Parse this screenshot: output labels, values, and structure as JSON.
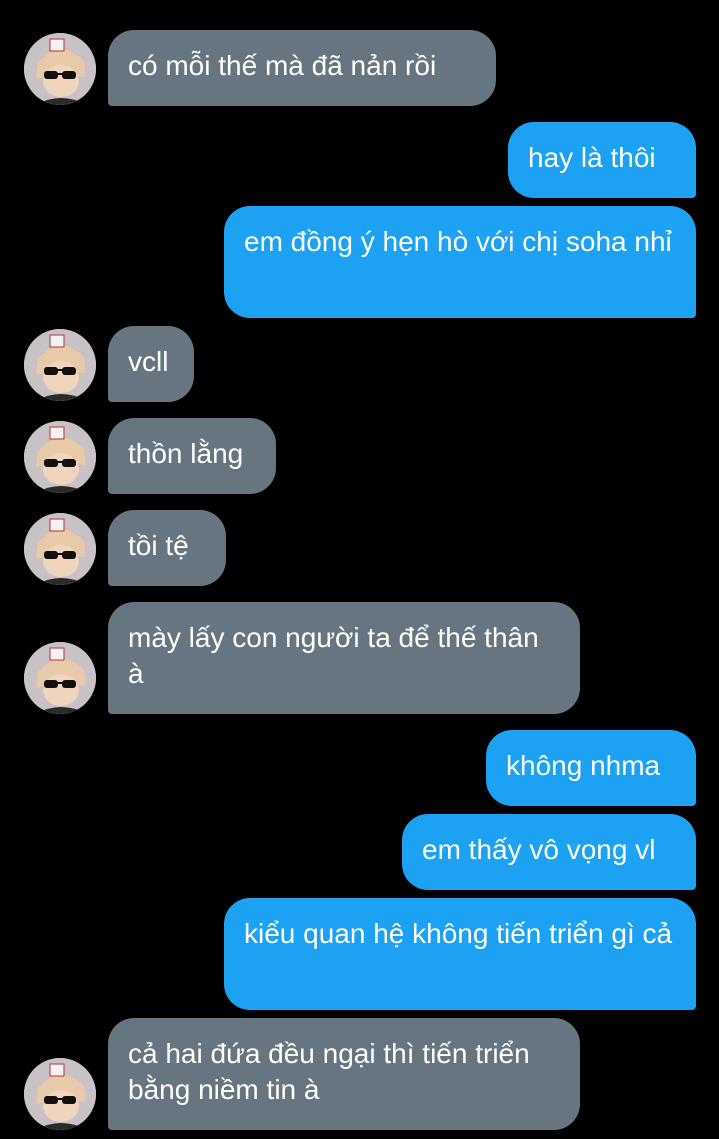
{
  "colors": {
    "background": "#000000",
    "received_bubble": "#66757f",
    "sent_bubble": "#1da1f2",
    "text": "#ffffff"
  },
  "avatar": {
    "icon": "user-avatar-sunglasses"
  },
  "messages": [
    {
      "sender": "other",
      "text": "có mỗi thế mà đã nản rồi"
    },
    {
      "sender": "me",
      "text": "hay là thôi"
    },
    {
      "sender": "me",
      "text": "em đồng ý hẹn hò với chị soha nhỉ"
    },
    {
      "sender": "other",
      "text": "vcll"
    },
    {
      "sender": "other",
      "text": "thồn lằng"
    },
    {
      "sender": "other",
      "text": "tồi tệ"
    },
    {
      "sender": "other",
      "text": "mày lấy con người ta để thế thân à"
    },
    {
      "sender": "me",
      "text": "không nhma"
    },
    {
      "sender": "me",
      "text": "em thấy vô vọng vl"
    },
    {
      "sender": "me",
      "text": "kiểu quan hệ không tiến triển gì cả"
    },
    {
      "sender": "other",
      "text": "cả hai đứa đều ngại thì tiến triển bằng niềm tin à"
    }
  ]
}
